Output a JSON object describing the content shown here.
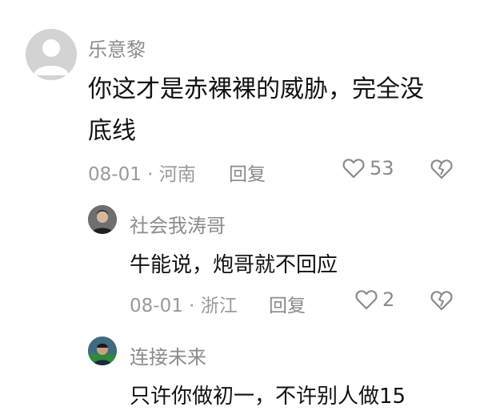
{
  "comments": [
    {
      "username": "乐意黎",
      "content_line1": "你这才是赤裸裸的威胁，完全没",
      "content_line2": "底线",
      "date": "08-01",
      "separator": "·",
      "location": "河南",
      "reply_label": "回复",
      "likes": "53"
    }
  ],
  "replies": [
    {
      "username": "社会我涛哥",
      "content": "牛能说，炮哥就不回应",
      "date": "08-01",
      "separator": "·",
      "location": "浙江",
      "reply_label": "回复",
      "likes": "2"
    },
    {
      "username": "连接未来",
      "content": "只许你做初一，不许别人做15"
    }
  ],
  "icons": {
    "like": "heart-icon",
    "dislike": "broken-heart-icon"
  },
  "colors": {
    "muted_text": "#8c8c8c",
    "main_text": "#111111"
  }
}
